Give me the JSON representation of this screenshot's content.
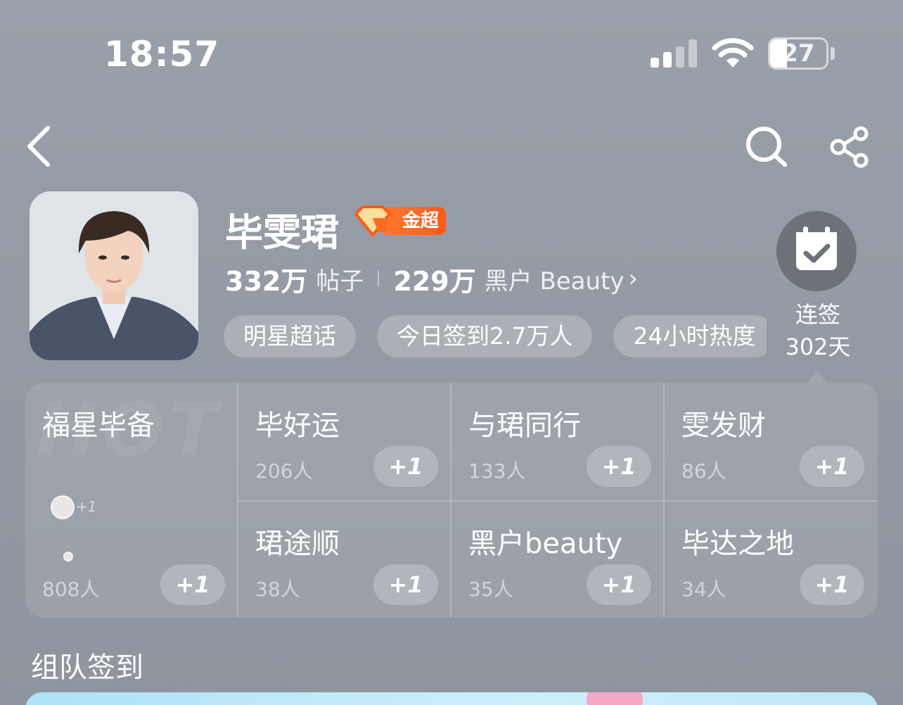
{
  "status_bar": {
    "time": "18:57",
    "battery_level": "27",
    "signal_bars": 2
  },
  "header": {
    "back": "back",
    "search": "search",
    "share": "share"
  },
  "profile": {
    "name": "毕雯珺",
    "level_badge": "金超",
    "posts_count": "332万",
    "posts_label": "帖子",
    "fans_count": "229万",
    "fans_label": "黑户 Beauty",
    "tags": [
      "明星超话",
      "今日签到2.7万人",
      "24小时热度"
    ]
  },
  "checkin": {
    "label": "连签",
    "days": "302天"
  },
  "groups": {
    "hot_watermark": "HOT",
    "featured": {
      "title": "福星毕备",
      "count": "808人",
      "mini_plus": "+1",
      "button": "+1"
    },
    "items": [
      {
        "title": "毕好运",
        "count": "206人",
        "button": "+1"
      },
      {
        "title": "与珺同行",
        "count": "133人",
        "button": "+1"
      },
      {
        "title": "雯发财",
        "count": "86人",
        "button": "+1"
      },
      {
        "title": "珺途顺",
        "count": "38人",
        "button": "+1"
      },
      {
        "title": "黑户beauty",
        "count": "35人",
        "button": "+1"
      },
      {
        "title": "毕达之地",
        "count": "34人",
        "button": "+1"
      }
    ]
  },
  "team_checkin": {
    "title": "组队签到"
  },
  "colors": {
    "badge_orange": "#ff6a22",
    "checkin_bg": "#6d7178"
  }
}
